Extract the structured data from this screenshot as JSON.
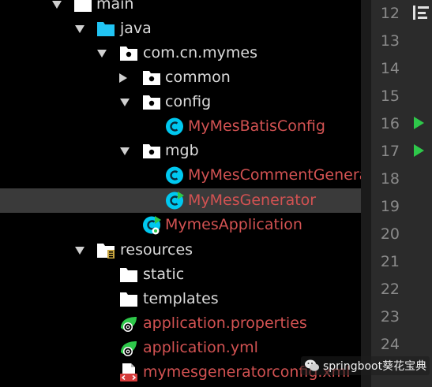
{
  "tree": {
    "items": [
      {
        "label": "main",
        "icon": "folder-icon"
      },
      {
        "label": "java",
        "icon": "source-folder-icon"
      },
      {
        "label": "com.cn.mymes",
        "icon": "package-icon"
      },
      {
        "label": "common",
        "icon": "package-icon"
      },
      {
        "label": "config",
        "icon": "package-icon"
      },
      {
        "label": "MyMesBatisConfig",
        "icon": "class-icon"
      },
      {
        "label": "mgb",
        "icon": "package-icon"
      },
      {
        "label": "MyMesCommentGenerator",
        "icon": "class-icon"
      },
      {
        "label": "MyMesGenerator",
        "icon": "runnable-class-icon"
      },
      {
        "label": "MymesApplication",
        "icon": "spring-boot-class-icon"
      },
      {
        "label": "resources",
        "icon": "resources-folder-icon"
      },
      {
        "label": "static",
        "icon": "folder-icon"
      },
      {
        "label": "templates",
        "icon": "folder-icon"
      },
      {
        "label": "application.properties",
        "icon": "spring-properties-icon"
      },
      {
        "label": "application.yml",
        "icon": "spring-yml-icon"
      },
      {
        "label": "mymesgeneratorconfig.xml",
        "icon": "xml-file-icon"
      }
    ]
  },
  "gutter": {
    "line_numbers": [
      "12",
      "13",
      "14",
      "15",
      "16",
      "17",
      "18",
      "19",
      "20",
      "21",
      "22",
      "23",
      "24"
    ],
    "run_markers_on_lines": [
      "16",
      "17"
    ]
  },
  "watermark": {
    "text": "springboot葵花宝典"
  },
  "colors": {
    "modified_file_red": "#d25252",
    "class_icon_cyan": "#00c8f0",
    "run_green": "#2ec84a",
    "selection": "#3a3a3a"
  }
}
